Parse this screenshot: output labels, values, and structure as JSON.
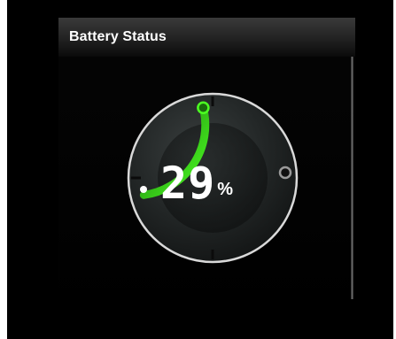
{
  "panel": {
    "title": "Battery Status"
  },
  "battery": {
    "level_percent": 29,
    "value_text": "29",
    "unit": "%"
  },
  "colors": {
    "background": "#000000",
    "title_bar": "#2a2a2a",
    "accent_green": "#36e01a",
    "ring": "#d9d9d9"
  },
  "icons": {
    "start_marker": "white-dot",
    "end_marker": "ring-knob",
    "fill_marker": "green-knob"
  }
}
